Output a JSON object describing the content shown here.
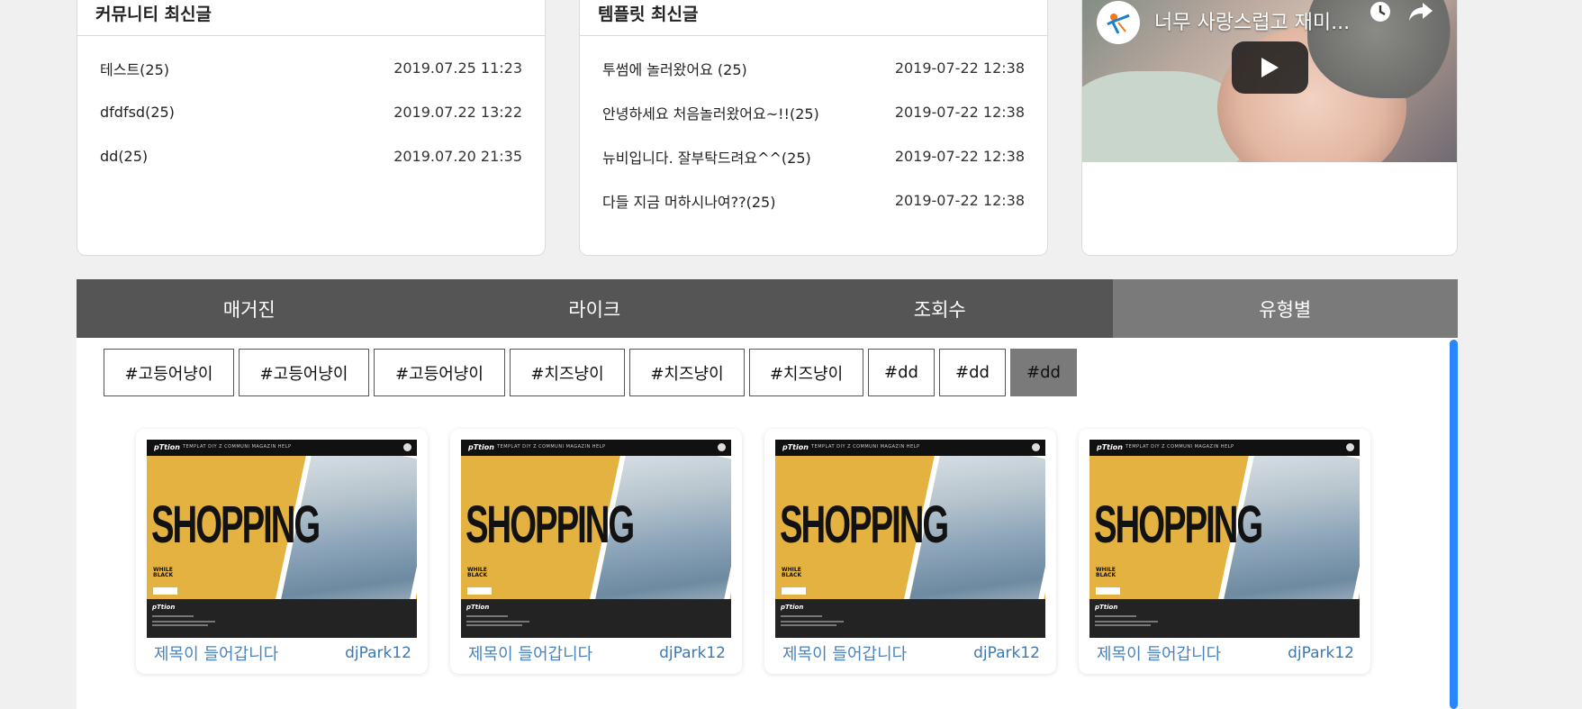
{
  "community": {
    "title": "커뮤니티 최신글",
    "posts": [
      {
        "title": "테스트(25)",
        "date": "2019.07.25 11:23"
      },
      {
        "title": "dfdfsd(25)",
        "date": "2019.07.22 13:22"
      },
      {
        "title": "dd(25)",
        "date": "2019.07.20 21:35"
      }
    ]
  },
  "template": {
    "title": "템플릿 최신글",
    "posts": [
      {
        "title": "투썸에 놀러왔어요 (25)",
        "date": "2019-07-22 12:38"
      },
      {
        "title": "안녕하세요 처음놀러왔어요~!!(25)",
        "date": "2019-07-22 12:38"
      },
      {
        "title": "뉴비입니다. 잘부탁드려요^^(25)",
        "date": "2019-07-22 12:38"
      },
      {
        "title": "다들 지금 머하시나여??(25)",
        "date": "2019-07-22 12:38"
      }
    ]
  },
  "video": {
    "title": "너무 사랑스럽고 재미...",
    "icons": [
      "channel-logo-icon",
      "watch-later-icon",
      "share-icon",
      "play-icon"
    ]
  },
  "tabs": [
    {
      "label": "매거진",
      "active": false
    },
    {
      "label": "라이크",
      "active": false
    },
    {
      "label": "조회수",
      "active": false
    },
    {
      "label": "유형별",
      "active": true
    }
  ],
  "tags": [
    {
      "label": "#고등어냥이",
      "active": false
    },
    {
      "label": "#고등어냥이",
      "active": false
    },
    {
      "label": "#고등어냥이",
      "active": false
    },
    {
      "label": "#치즈냥이",
      "active": false
    },
    {
      "label": "#치즈냥이",
      "active": false
    },
    {
      "label": "#치즈냥이",
      "active": false
    },
    {
      "label": "#dd",
      "active": false
    },
    {
      "label": "#dd",
      "active": false
    },
    {
      "label": "#dd",
      "active": true
    }
  ],
  "cards": [
    {
      "title": "제목이 들어갑니다",
      "author": "djPark12",
      "thumb_word": "SHOPPING",
      "thumb_sub1": "WHILE",
      "thumb_sub2": "BLACK"
    },
    {
      "title": "제목이 들어갑니다",
      "author": "djPark12",
      "thumb_word": "SHOPPING",
      "thumb_sub1": "WHILE",
      "thumb_sub2": "BLACK"
    },
    {
      "title": "제목이 들어갑니다",
      "author": "djPark12",
      "thumb_word": "SHOPPING",
      "thumb_sub1": "WHILE",
      "thumb_sub2": "BLACK"
    },
    {
      "title": "제목이 들어갑니다",
      "author": "djPark12",
      "thumb_word": "SHOPPING",
      "thumb_sub1": "WHILE",
      "thumb_sub2": "BLACK"
    }
  ],
  "colors": {
    "tab_bg": "#555555",
    "tab_active_bg": "#7a7a7a",
    "link_blue": "#4a84bd",
    "scrollbar": "#2a86ff",
    "thumb_yellow": "#e3b240"
  }
}
